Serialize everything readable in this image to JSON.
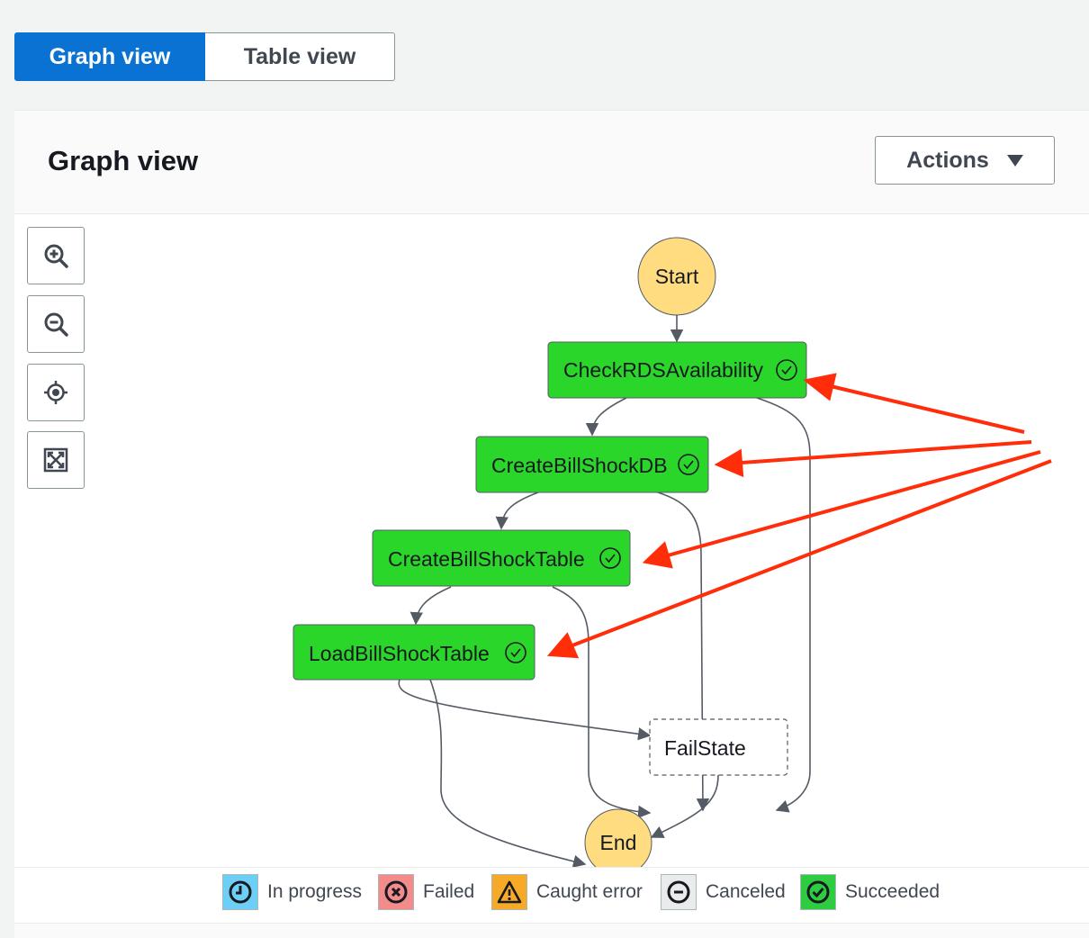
{
  "tabs": [
    {
      "label": "Graph view",
      "active": true
    },
    {
      "label": "Table view",
      "active": false
    }
  ],
  "panel": {
    "title": "Graph view",
    "actions_label": "Actions",
    "actions_icon": "caret-down-icon"
  },
  "zoom_controls": [
    {
      "name": "zoom-in-button",
      "icon": "zoom-in-icon"
    },
    {
      "name": "zoom-out-button",
      "icon": "zoom-out-icon"
    },
    {
      "name": "center-button",
      "icon": "crosshair-icon"
    },
    {
      "name": "fit-button",
      "icon": "expand-icon"
    }
  ],
  "graph": {
    "start_label": "Start",
    "end_label": "End",
    "states": [
      {
        "label": "CheckRDSAvailability",
        "status": "Succeeded"
      },
      {
        "label": "CreateBillShockDB",
        "status": "Succeeded"
      },
      {
        "label": "CreateBillShockTable",
        "status": "Succeeded"
      },
      {
        "label": "LoadBillShockTable",
        "status": "Succeeded"
      },
      {
        "label": "FailState",
        "status": "Not executed"
      }
    ]
  },
  "legend": [
    {
      "label": "In progress",
      "icon": "clock-icon",
      "color": "#6dcff6"
    },
    {
      "label": "Failed",
      "icon": "x-circle-icon",
      "color": "#f38b8b"
    },
    {
      "label": "Caught error",
      "icon": "warning-icon",
      "color": "#f7a928"
    },
    {
      "label": "Canceled",
      "icon": "minus-circle-icon",
      "color": "#e9ebed"
    },
    {
      "label": "Succeeded",
      "icon": "check-circle-icon",
      "color": "#2ecc40"
    }
  ],
  "colors": {
    "primary": "#0972d3",
    "succeeded": "#2bd62b",
    "start_end": "#ffdc80",
    "annotation_arrow": "#ff2d0a"
  }
}
